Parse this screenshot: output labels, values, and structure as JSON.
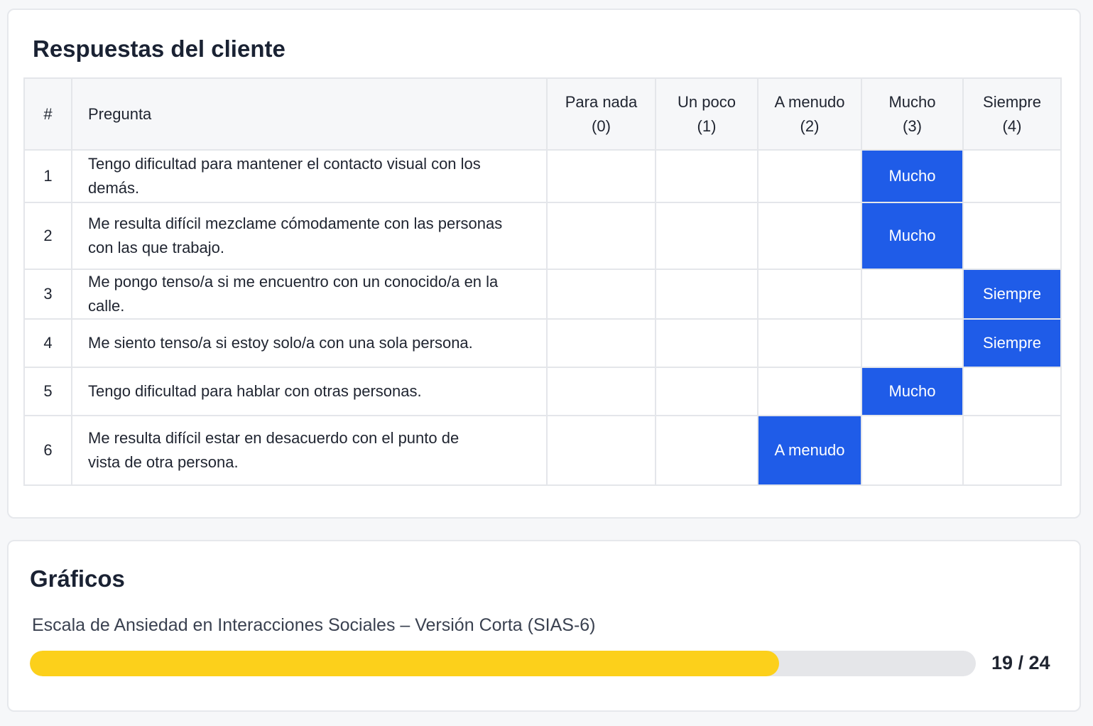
{
  "responses": {
    "title": "Respuestas del cliente",
    "columns": {
      "num": "#",
      "question": "Pregunta",
      "options": [
        {
          "line1": "Para nada",
          "line2": "(0)"
        },
        {
          "line1": "Un poco",
          "line2": "(1)"
        },
        {
          "line1": "A menudo",
          "line2": "(2)"
        },
        {
          "line1": "Mucho",
          "line2": "(3)"
        },
        {
          "line1": "Siempre",
          "line2": "(4)"
        }
      ]
    },
    "rows": [
      {
        "num": "1",
        "question_line1": "Tengo dificultad para mantener el contacto visual con los demás.",
        "question_line2": "",
        "selected": 3,
        "selected_label": "Mucho"
      },
      {
        "num": "2",
        "question_line1": "Me resulta difícil mezclame cómodamente con las personas",
        "question_line2": "con las que trabajo.",
        "selected": 3,
        "selected_label": "Mucho"
      },
      {
        "num": "3",
        "question_line1": "Me pongo tenso/a si me encuentro con un conocido/a en la calle.",
        "question_line2": "",
        "selected": 4,
        "selected_label": "Siempre"
      },
      {
        "num": "4",
        "question_line1": "Me siento tenso/a si estoy solo/a con una sola persona.",
        "question_line2": "",
        "selected": 4,
        "selected_label": "Siempre"
      },
      {
        "num": "5",
        "question_line1": "Tengo dificultad para hablar con otras personas.",
        "question_line2": "",
        "selected": 3,
        "selected_label": "Mucho"
      },
      {
        "num": "6",
        "question_line1": "Me resulta difícil estar en desacuerdo con el punto de",
        "question_line2": "vista de otra persona.",
        "selected": 2,
        "selected_label": "A menudo"
      }
    ],
    "selected_color": "#1f5ce8"
  },
  "charts": {
    "title": "Gráficos",
    "scale_name": "Escala de Ansiedad en Interacciones Sociales – Versión Corta (SIAS-6)",
    "score": 19,
    "max": 24,
    "score_text": "19 / 24",
    "bar_color": "#fcd01b"
  }
}
